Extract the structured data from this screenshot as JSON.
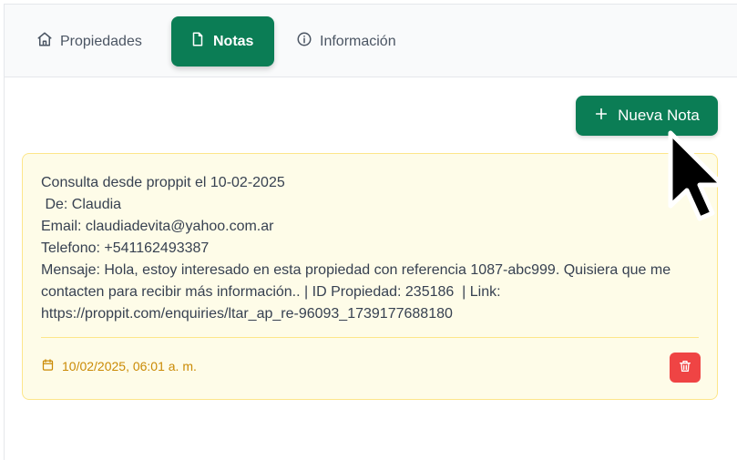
{
  "tabs": [
    {
      "label": "Propiedades",
      "icon": "home-icon",
      "active": false
    },
    {
      "label": "Notas",
      "icon": "file-icon",
      "active": true
    },
    {
      "label": "Información",
      "icon": "info-icon",
      "active": false
    }
  ],
  "toolbar": {
    "new_note_label": "Nueva Nota",
    "new_note_icon": "plus-icon"
  },
  "note": {
    "lines": [
      "Consulta desde proppit el 10-02-2025",
      " De: Claudia",
      "Email: claudiadevita@yahoo.com.ar",
      "Telefono: +541162493387",
      "Mensaje: Hola, estoy interesado en esta propiedad con referencia 1087-abc999. Quisiera que me contacten para recibir más información.. | ID Propiedad: 235186  | Link: https://proppit.com/enquiries/ltar_ap_re-96093_1739177688180"
    ],
    "date": "10/02/2025, 06:01 a. m.",
    "date_icon": "calendar-icon",
    "delete_icon": "trash-icon"
  },
  "colors": {
    "accent": "#0b7d55",
    "note_bg": "#fefce8",
    "note_border": "#fde68a",
    "date_text": "#ca8a04",
    "danger": "#ef4444"
  }
}
